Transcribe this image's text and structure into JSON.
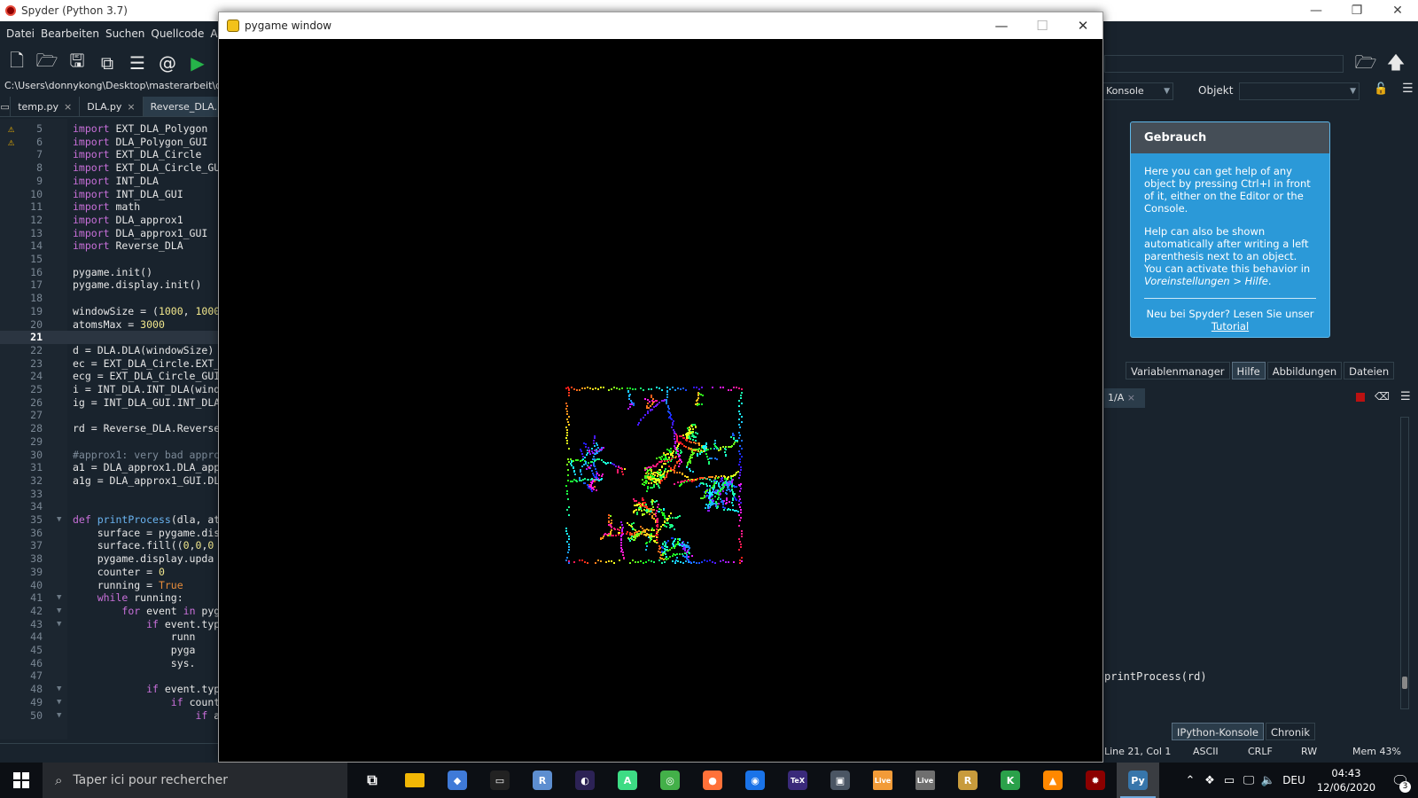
{
  "spyder": {
    "window_title": "Spyder (Python 3.7)",
    "menu": [
      "Datei",
      "Bearbeiten",
      "Suchen",
      "Quellcode",
      "Ausfü"
    ],
    "path": "C:\\Users\\donnykong\\Desktop\\masterarbeit\\dla\\py",
    "tabs": [
      {
        "label": "temp.py",
        "close": "×"
      },
      {
        "label": "DLA.py",
        "close": "×"
      },
      {
        "label": "Reverse_DLA.p",
        "close": ""
      }
    ],
    "code_lines": [
      {
        "n": "5",
        "warn": true,
        "fold": "",
        "html": "<span class=\"kw\">import</span> EXT_DLA_Polygon"
      },
      {
        "n": "6",
        "warn": true,
        "fold": "",
        "html": "<span class=\"kw\">import</span> DLA_Polygon_GUI"
      },
      {
        "n": "7",
        "fold": "",
        "html": "<span class=\"kw\">import</span> EXT_DLA_Circle"
      },
      {
        "n": "8",
        "fold": "",
        "html": "<span class=\"kw\">import</span> EXT_DLA_Circle_GU"
      },
      {
        "n": "9",
        "fold": "",
        "html": "<span class=\"kw\">import</span> INT_DLA"
      },
      {
        "n": "10",
        "fold": "",
        "html": "<span class=\"kw\">import</span> INT_DLA_GUI"
      },
      {
        "n": "11",
        "fold": "",
        "html": "<span class=\"kw\">import</span> math"
      },
      {
        "n": "12",
        "fold": "",
        "html": "<span class=\"kw\">import</span> DLA_approx1"
      },
      {
        "n": "13",
        "fold": "",
        "html": "<span class=\"kw\">import</span> DLA_approx1_GUI"
      },
      {
        "n": "14",
        "fold": "",
        "html": "<span class=\"kw\">import</span> Reverse_DLA"
      },
      {
        "n": "15",
        "fold": "",
        "html": ""
      },
      {
        "n": "16",
        "fold": "",
        "html": "pygame.init()"
      },
      {
        "n": "17",
        "fold": "",
        "html": "pygame.display.init()"
      },
      {
        "n": "18",
        "fold": "",
        "html": ""
      },
      {
        "n": "19",
        "fold": "",
        "html": "windowSize = (<span class=\"num\">1000</span>, <span class=\"num\">1000</span>"
      },
      {
        "n": "20",
        "fold": "",
        "html": "atomsMax = <span class=\"num\">3000</span>"
      },
      {
        "n": "21",
        "fold": "",
        "html": "",
        "current": true
      },
      {
        "n": "22",
        "fold": "",
        "html": "d = DLA.DLA(windowSize)"
      },
      {
        "n": "23",
        "fold": "",
        "html": "ec = EXT_DLA_Circle.EXT_"
      },
      {
        "n": "24",
        "fold": "",
        "html": "ecg = EXT_DLA_Circle_GUI"
      },
      {
        "n": "25",
        "fold": "",
        "html": "i = INT_DLA.INT_DLA(wind"
      },
      {
        "n": "26",
        "fold": "",
        "html": "ig = INT_DLA_GUI.INT_DLA"
      },
      {
        "n": "27",
        "fold": "",
        "html": ""
      },
      {
        "n": "28",
        "fold": "",
        "html": "rd = Reverse_DLA.Reverse"
      },
      {
        "n": "29",
        "fold": "",
        "html": ""
      },
      {
        "n": "30",
        "fold": "",
        "html": "<span class=\"cm\">#approx1: very bad appro</span>"
      },
      {
        "n": "31",
        "fold": "",
        "html": "a1 = DLA_approx1.DLA_app"
      },
      {
        "n": "32",
        "fold": "",
        "html": "a1g = DLA_approx1_GUI.DL"
      },
      {
        "n": "33",
        "fold": "",
        "html": ""
      },
      {
        "n": "34",
        "fold": "",
        "html": ""
      },
      {
        "n": "35",
        "fold": "▼",
        "html": "<span class=\"kw\">def</span> <span class=\"fn\">printProcess</span>(dla, at"
      },
      {
        "n": "36",
        "fold": "",
        "html": "    surface = pygame.dis"
      },
      {
        "n": "37",
        "fold": "",
        "html": "    surface.fill((<span class=\"num\">0</span>,<span class=\"num\">0</span>,<span class=\"num\">0</span>"
      },
      {
        "n": "38",
        "fold": "",
        "html": "    pygame.display.upda"
      },
      {
        "n": "39",
        "fold": "",
        "html": "    counter = <span class=\"num\">0</span>"
      },
      {
        "n": "40",
        "fold": "",
        "html": "    running = <span class=\"tr\">True</span>"
      },
      {
        "n": "41",
        "fold": "▼",
        "html": "    <span class=\"kw\">while</span> running:"
      },
      {
        "n": "42",
        "fold": "▼",
        "html": "        <span class=\"kw\">for</span> event <span class=\"kw\">in</span> pyg"
      },
      {
        "n": "43",
        "fold": "▼",
        "html": "            <span class=\"kw\">if</span> event.typ"
      },
      {
        "n": "44",
        "fold": "",
        "html": "                runn"
      },
      {
        "n": "45",
        "fold": "",
        "html": "                pyga"
      },
      {
        "n": "46",
        "fold": "",
        "html": "                sys."
      },
      {
        "n": "47",
        "fold": "",
        "html": ""
      },
      {
        "n": "48",
        "fold": "▼",
        "html": "            <span class=\"kw\">if</span> event.typ"
      },
      {
        "n": "49",
        "fold": "▼",
        "html": "                <span class=\"kw\">if</span> count"
      },
      {
        "n": "50",
        "fold": "▼",
        "html": "                    <span class=\"kw\">if</span> a"
      }
    ]
  },
  "pygame": {
    "window_title": "pygame window",
    "minimize": "—",
    "maximize": "☐",
    "close": "✕"
  },
  "right": {
    "console_combo": "Konsole",
    "object_label": "Objekt",
    "help_title": "Gebrauch",
    "help_p1": "Here you can get help of any object by pressing Ctrl+I in front of it, either on the Editor or the Console.",
    "help_p2a": "Help can also be shown automatically after writing a left parenthesis next to an object. You can activate this behavior in ",
    "help_p2b": "Voreinstellungen > Hilfe",
    "help_p2c": ".",
    "help_new": "Neu bei Spyder? Lesen Sie unser",
    "help_link": "Tutorial",
    "pane_tabs": [
      "Variablenmanager",
      "Hilfe",
      "Abbildungen",
      "Dateien"
    ],
    "console_tab": "1/A",
    "console_text": "printProcess(rd)",
    "bottom_tabs": [
      "IPython-Konsole",
      "Chronik"
    ]
  },
  "status": {
    "pos": "Line 21, Col 1",
    "enc": "ASCII",
    "eol": "CRLF",
    "rw": "RW",
    "mem": "Mem 43%"
  },
  "taskbar": {
    "search_placeholder": "Taper ici pour rechercher",
    "lang": "DEU",
    "time": "04:43",
    "date": "12/06/2020",
    "notifications": "3",
    "apps": [
      {
        "name": "task-view-icon",
        "color": "#0c0f14",
        "glyph": "⧉"
      },
      {
        "name": "file-explorer-icon",
        "color": "#f2b705",
        "glyph": ""
      },
      {
        "name": "git-icon",
        "color": "#3f7ad8",
        "glyph": "◆"
      },
      {
        "name": "terminal-icon",
        "color": "#222222",
        "glyph": "▭"
      },
      {
        "name": "r-icon",
        "color": "#5d8ed0",
        "glyph": "R"
      },
      {
        "name": "eclipse-icon",
        "color": "#2c2255",
        "glyph": "◐"
      },
      {
        "name": "android-studio-icon",
        "color": "#3ddc84",
        "glyph": "A"
      },
      {
        "name": "anaconda-icon",
        "color": "#43b049",
        "glyph": "◎"
      },
      {
        "name": "firefox-icon",
        "color": "#ff7139",
        "glyph": "●"
      },
      {
        "name": "chrome-icon",
        "color": "#1a73e8",
        "glyph": "◉"
      },
      {
        "name": "texstudio-icon",
        "color": "#3a2a7a",
        "glyph": "TeX"
      },
      {
        "name": "camera-icon",
        "color": "#4a5563",
        "glyph": "▣"
      },
      {
        "name": "livecode-orange-icon",
        "color": "#f29b38",
        "glyph": "Live"
      },
      {
        "name": "livecode-gray-icon",
        "color": "#6f6f6f",
        "glyph": "Live"
      },
      {
        "name": "riot-icon",
        "color": "#c89b3c",
        "glyph": "R"
      },
      {
        "name": "kile-icon",
        "color": "#2aa14a",
        "glyph": "K"
      },
      {
        "name": "vlc-icon",
        "color": "#ff8800",
        "glyph": "▲"
      },
      {
        "name": "spyder-web-icon",
        "color": "#8c0000",
        "glyph": "✹"
      },
      {
        "name": "python-icon",
        "color": "#3776ab",
        "glyph": "Py"
      }
    ]
  },
  "colors": {
    "spyder_bg": "#19232d",
    "help_blue": "#2b99d8",
    "run_green": "#26b34a",
    "warn_yellow": "#f0b400"
  }
}
